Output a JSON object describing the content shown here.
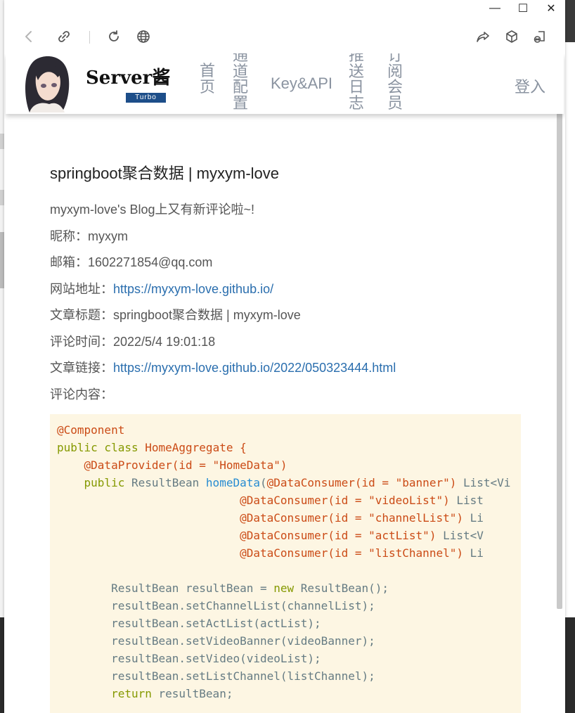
{
  "window": {
    "controls": {
      "minimize": "—",
      "maximize": "☐",
      "close": "✕"
    }
  },
  "toolbar": {
    "icons": [
      "back-icon",
      "link-icon",
      "reload-icon",
      "globe-icon",
      "share-icon",
      "cube-icon",
      "extensions-icon"
    ]
  },
  "site": {
    "logo": "Server酱",
    "badge": "Turbo",
    "nav": {
      "home": "首页",
      "channel": "通道配置",
      "key": "Key&API",
      "push_log": "推送日志",
      "subscribe": "订阅会员",
      "login": "登入"
    }
  },
  "post": {
    "title": "springboot聚合数据 | myxym-love",
    "intro": "myxym-love's Blog上又有新评论啦~!",
    "nick_label": "昵称：",
    "nick": "myxym",
    "mail_label": "邮箱：",
    "mail": "1602271854@qq.com",
    "site_label": "网站地址：",
    "site": "https://myxym-love.github.io/",
    "art_title_label": "文章标题：",
    "art_title": "springboot聚合数据 | myxym-love",
    "time_label": "评论时间：",
    "time": "2022/5/4 19:01:18",
    "link_label": "文章链接：",
    "link": "https://myxym-love.github.io/2022/050323444.html",
    "comment_label": "评论内容："
  },
  "code": {
    "l1": "@Component",
    "l2a": "public class ",
    "l2b": "HomeAggregate {",
    "l3a": "    ",
    "l3b": "@DataProvider(id = \"HomeData\")",
    "l4a": "    ",
    "l4b": "public",
    "l4c": " ResultBean ",
    "l4d": "homeData",
    "l4e": "(",
    "l4f": "@DataConsumer(id = \"banner\")",
    "l4g": " List<Vi",
    "l5": "@DataConsumer(id = \"videoList\")",
    "l5t": " List",
    "l6": "@DataConsumer(id = \"channelList\")",
    "l6t": " Li",
    "l7": "@DataConsumer(id = \"actList\")",
    "l7t": " List<V",
    "l8": "@DataConsumer(id = \"listChannel\")",
    "l8t": " Li",
    "l10a": "        ResultBean resultBean = ",
    "l10b": "new",
    "l10c": " ResultBean();",
    "l11": "        resultBean.setChannelList(channelList);",
    "l12": "        resultBean.setActList(actList);",
    "l13": "        resultBean.setVideoBanner(videoBanner);",
    "l14": "        resultBean.setVideo(videoList);",
    "l15": "        resultBean.setListChannel(listChannel);",
    "l16a": "        ",
    "l16b": "return",
    "l16c": " resultBean;"
  }
}
